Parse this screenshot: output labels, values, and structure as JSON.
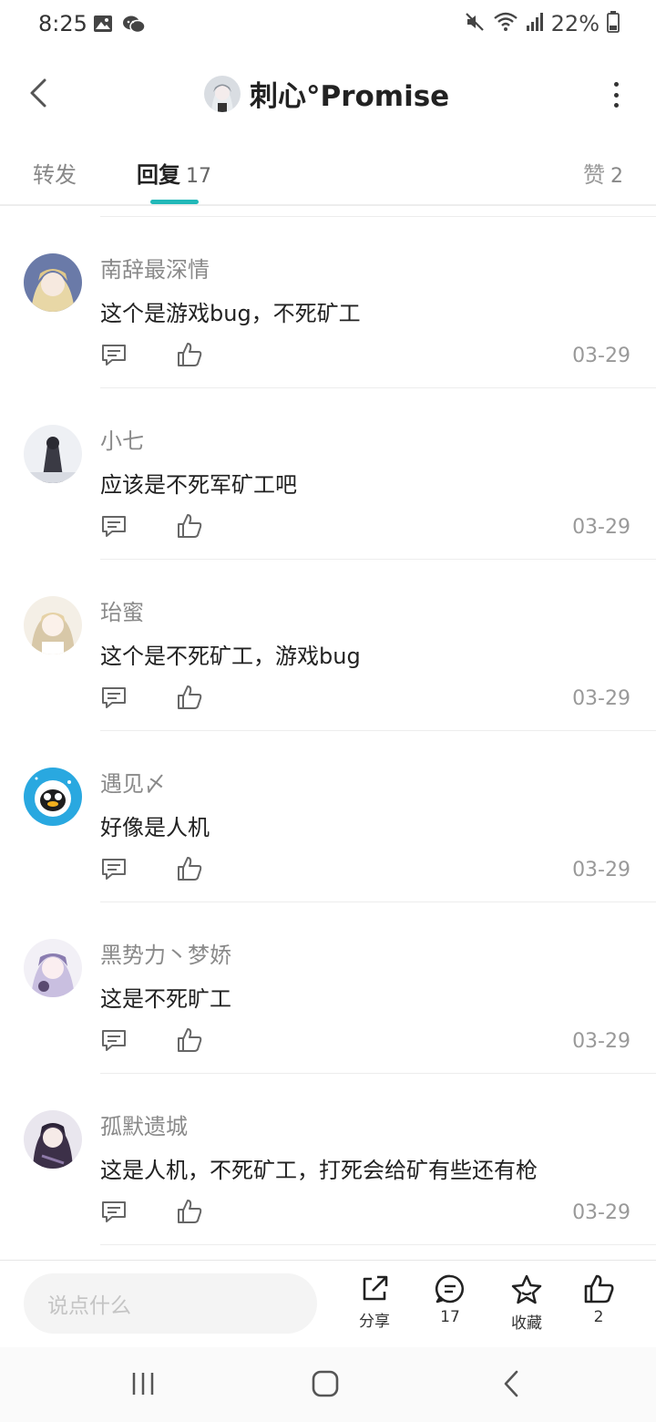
{
  "status_bar": {
    "time": "8:25",
    "battery": "22%",
    "icons": [
      "image-icon",
      "wechat-icon",
      "mute-icon",
      "wifi-icon",
      "signal-icon",
      "battery-icon"
    ]
  },
  "header": {
    "title": "刺心°Promise",
    "back_icon": "chevron-left-icon",
    "more_icon": "more-vertical-icon"
  },
  "tabs": {
    "forward": "转发",
    "reply": "回复",
    "reply_count": "17",
    "like": "赞",
    "like_count": "2"
  },
  "comments": [
    {
      "name": "南辞最深情",
      "text": "这个是游戏bug，不死矿工",
      "date": "03-29",
      "avatar_color": "#6a7aa8"
    },
    {
      "name": "小七",
      "text": "应该是不死军矿工吧",
      "date": "03-29",
      "avatar_color": "#3a3a44"
    },
    {
      "name": "珆蜜",
      "text": "这个是不死矿工，游戏bug",
      "date": "03-29",
      "avatar_color": "#d8c8a8"
    },
    {
      "name": "遇见〆",
      "text": "好像是人机",
      "date": "03-29",
      "avatar_color": "#29a8e0"
    },
    {
      "name": "黑势力丶梦娇",
      "text": "这是不死旷工",
      "date": "03-29",
      "avatar_color": "#8a7cb0"
    },
    {
      "name": "孤默遗城",
      "text": "这是人机，不死矿工，打死会给矿有些还有枪",
      "date": "03-29",
      "avatar_color": "#3c3048"
    }
  ],
  "action_bar": {
    "input_placeholder": "说点什么",
    "share_label": "分享",
    "comment_count": "17",
    "fav_label": "收藏",
    "like_count": "2"
  },
  "colors": {
    "accent": "#22b8b8",
    "text_primary": "#222222",
    "text_secondary": "#8a8a8a",
    "divider": "#ededed"
  }
}
